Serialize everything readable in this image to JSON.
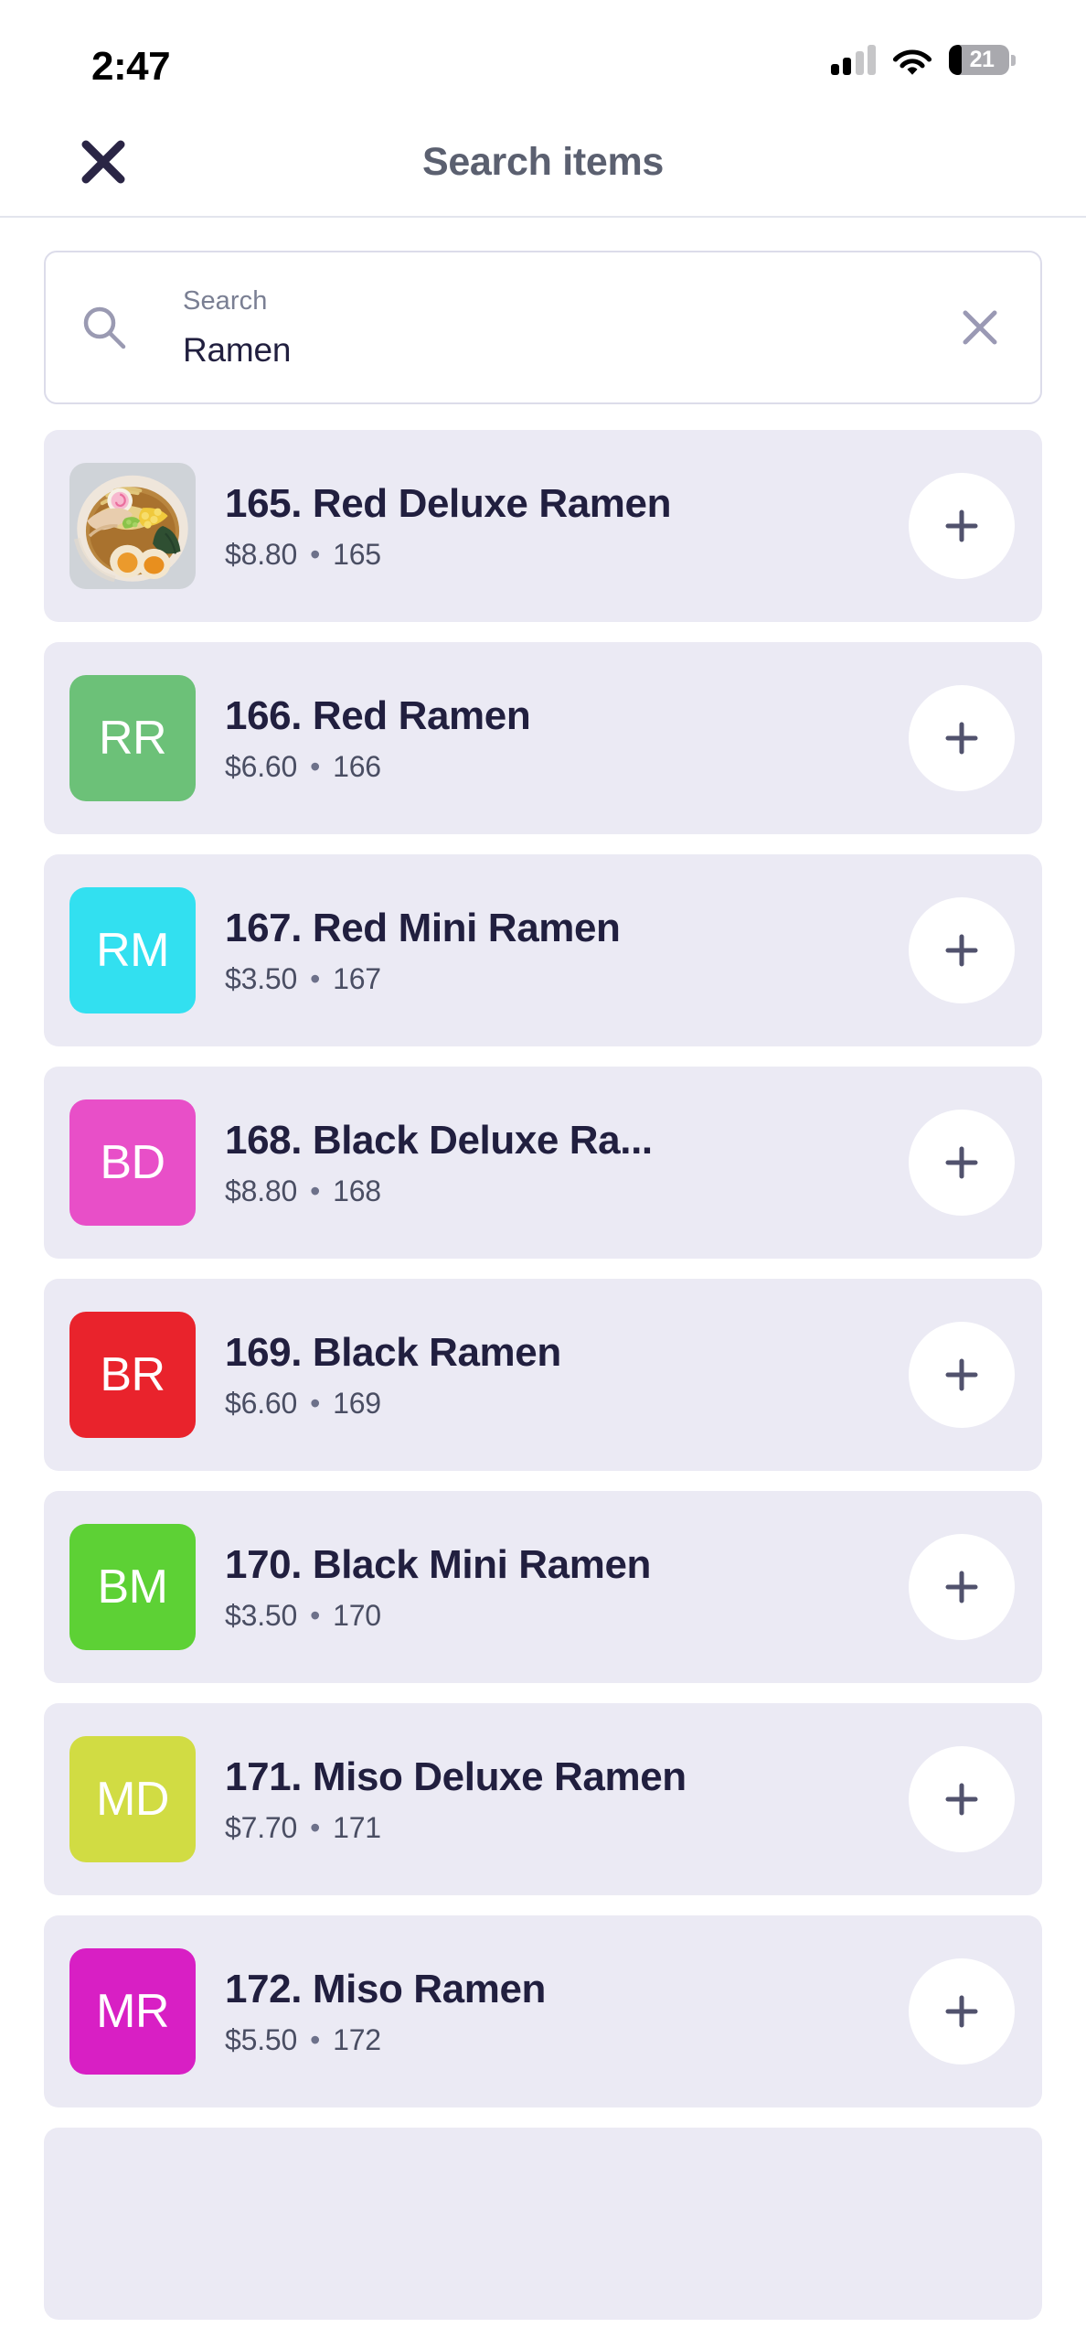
{
  "status_bar": {
    "time": "2:47",
    "battery_percent": "21",
    "signal_icon": "cellular-signal-icon",
    "wifi_icon": "wifi-icon",
    "battery_icon": "battery-icon"
  },
  "header": {
    "title": "Search items",
    "close_icon": "close-icon"
  },
  "search": {
    "label": "Search",
    "value": "Ramen",
    "placeholder": "Search",
    "search_icon": "search-icon",
    "clear_icon": "clear-icon"
  },
  "list": {
    "add_icon": "plus-icon",
    "card_bg": "#ebeaf4",
    "items": [
      {
        "title": "165. Red Deluxe Ramen",
        "price": "$8.80",
        "separator": "•",
        "code": "165",
        "thumb_type": "photo",
        "thumb_alt": "ramen-bowl-photo",
        "initials": "",
        "color": ""
      },
      {
        "title": "166. Red Ramen",
        "price": "$6.60",
        "separator": "•",
        "code": "166",
        "thumb_type": "initials",
        "thumb_alt": "item-initials-avatar",
        "initials": "RR",
        "color": "#6cc178"
      },
      {
        "title": "167. Red Mini Ramen",
        "price": "$3.50",
        "separator": "•",
        "code": "167",
        "thumb_type": "initials",
        "thumb_alt": "item-initials-avatar",
        "initials": "RM",
        "color": "#32e0f0"
      },
      {
        "title": "168. Black Deluxe Ra...",
        "price": "$8.80",
        "separator": "•",
        "code": "168",
        "thumb_type": "initials",
        "thumb_alt": "item-initials-avatar",
        "initials": "BD",
        "color": "#e84fc8"
      },
      {
        "title": "169. Black Ramen",
        "price": "$6.60",
        "separator": "•",
        "code": "169",
        "thumb_type": "initials",
        "thumb_alt": "item-initials-avatar",
        "initials": "BR",
        "color": "#e9232c"
      },
      {
        "title": "170. Black Mini Ramen",
        "price": "$3.50",
        "separator": "•",
        "code": "170",
        "thumb_type": "initials",
        "thumb_alt": "item-initials-avatar",
        "initials": "BM",
        "color": "#5dd135"
      },
      {
        "title": "171. Miso Deluxe Ramen",
        "price": "$7.70",
        "separator": "•",
        "code": "171",
        "thumb_type": "initials",
        "thumb_alt": "item-initials-avatar",
        "initials": "MD",
        "color": "#d1dc43"
      },
      {
        "title": "172. Miso Ramen",
        "price": "$5.50",
        "separator": "•",
        "code": "172",
        "thumb_type": "initials",
        "thumb_alt": "item-initials-avatar",
        "initials": "MR",
        "color": "#d81fc4"
      }
    ]
  }
}
